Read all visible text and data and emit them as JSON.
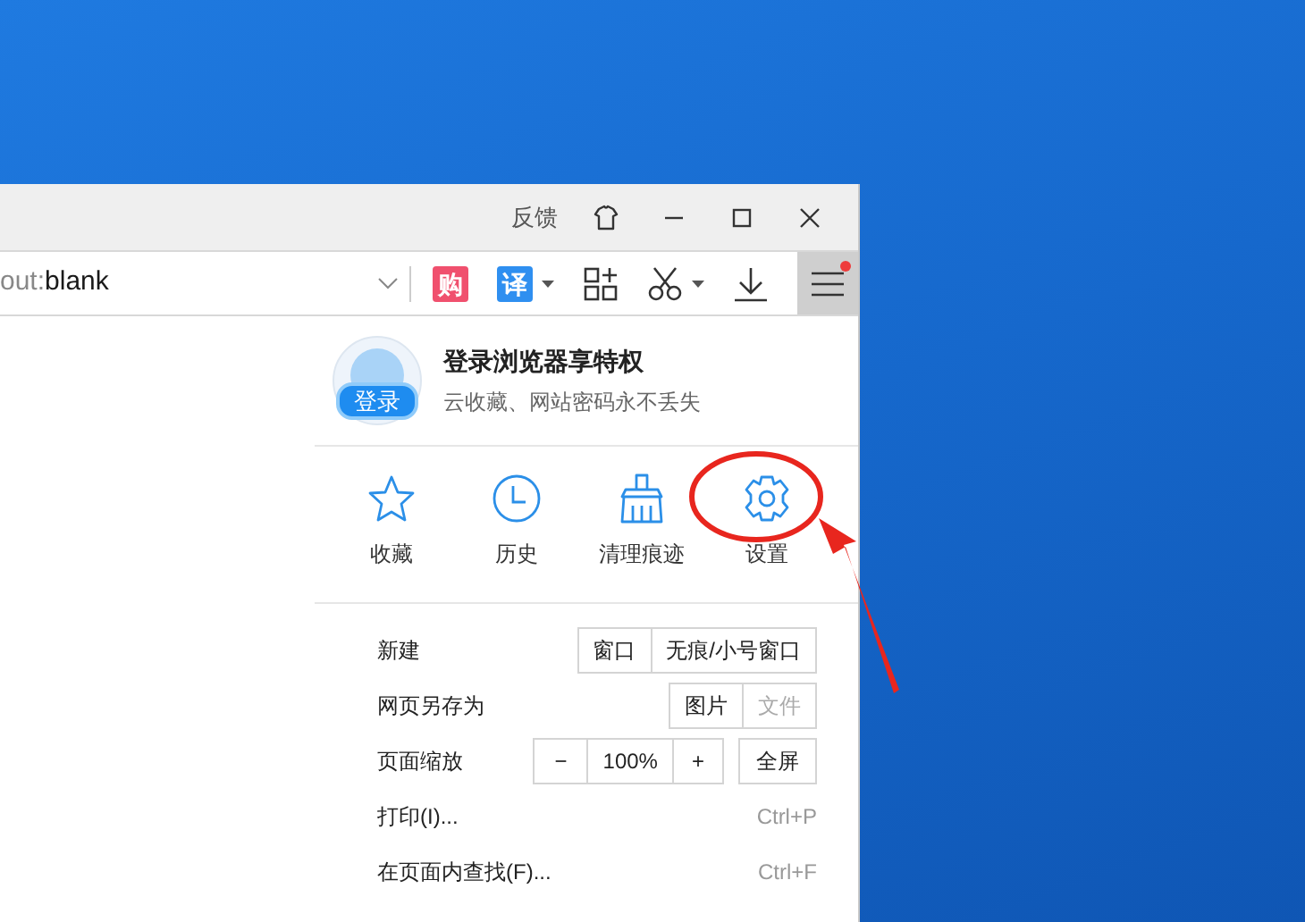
{
  "window": {
    "feedback": "反馈",
    "menu_open": true,
    "menu_badge": true
  },
  "address_bar": {
    "scheme_part": "out:",
    "rest": "blank"
  },
  "toolbar": [
    {
      "kind": "badge",
      "label": "购",
      "color": "#f0506e",
      "dropdown": false
    },
    {
      "kind": "badge",
      "label": "译",
      "color": "#2f8ff0",
      "dropdown": true
    },
    {
      "kind": "apps",
      "dropdown": false
    },
    {
      "kind": "scissors",
      "dropdown": true
    },
    {
      "kind": "download",
      "dropdown": false
    }
  ],
  "account": {
    "login_badge": "登录",
    "title": "登录浏览器享特权",
    "subtitle": "云收藏、网站密码永不丢失"
  },
  "quick_actions": [
    {
      "kind": "star",
      "label": "收藏"
    },
    {
      "kind": "clock",
      "label": "历史"
    },
    {
      "kind": "broom",
      "label": "清理痕迹"
    },
    {
      "kind": "gear",
      "label": "设置"
    }
  ],
  "menu_rows": [
    {
      "kind": "buttons",
      "label": "新建",
      "buttons": [
        {
          "label": "窗口",
          "disabled": false
        },
        {
          "label": "无痕/小号窗口",
          "disabled": false
        }
      ]
    },
    {
      "kind": "buttons",
      "label": "网页另存为",
      "buttons": [
        {
          "label": "图片",
          "disabled": false
        },
        {
          "label": "文件",
          "disabled": true
        }
      ]
    },
    {
      "kind": "zoom",
      "label": "页面缩放",
      "minus": "−",
      "value": "100%",
      "plus": "+",
      "fullscreen": "全屏"
    },
    {
      "kind": "shortcut",
      "label": "打印(I)...",
      "shortcut": "Ctrl+P"
    },
    {
      "kind": "shortcut",
      "label": "在页面内查找(F)...",
      "shortcut": "Ctrl+F"
    }
  ]
}
